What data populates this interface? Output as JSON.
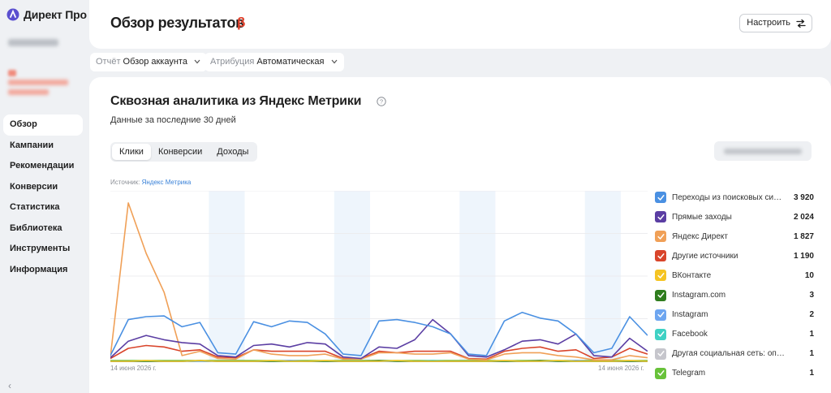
{
  "app": {
    "name": "Директ Про"
  },
  "sidebar": {
    "nav": [
      {
        "label": "Обзор",
        "active": true
      },
      {
        "label": "Кампании",
        "active": false
      },
      {
        "label": "Рекомендации",
        "active": false
      },
      {
        "label": "Конверсии",
        "active": false
      },
      {
        "label": "Статистика",
        "active": false
      },
      {
        "label": "Библиотека",
        "active": false
      },
      {
        "label": "Инструменты",
        "active": false
      },
      {
        "label": "Информация",
        "active": false
      }
    ],
    "collapse_icon": "chevron-left-icon"
  },
  "header": {
    "title": "Обзор результатов",
    "beta": "β",
    "setup_button": "Настроить"
  },
  "filters": {
    "report": {
      "label": "Отчёт",
      "value": "Обзор аккаунта"
    },
    "attribution": {
      "label": "Атрибуция",
      "value": "Автоматическая"
    }
  },
  "section": {
    "title": "Сквозная аналитика из Яндекс Метрики",
    "subtitle": "Данные за последние 30 дней",
    "tabs": [
      {
        "label": "Клики",
        "active": true
      },
      {
        "label": "Конверсии",
        "active": false
      },
      {
        "label": "Доходы",
        "active": false
      }
    ],
    "source_label": "Источник:",
    "source_link": "Яндекс Метрика"
  },
  "chart_data": {
    "type": "line",
    "x_start_label": "14 июня 2026 г.",
    "x_end_label": "14 июня 2026 г.",
    "ylim": [
      0,
      230
    ],
    "series": [
      {
        "name": "Переходы из поисковых сист...",
        "total": "3 920",
        "color": "#4a90e2",
        "values": [
          8,
          58,
          62,
          63,
          48,
          54,
          12,
          10,
          55,
          48,
          56,
          54,
          38,
          10,
          8,
          56,
          58,
          54,
          48,
          38,
          10,
          8,
          56,
          68,
          60,
          56,
          38,
          12,
          18,
          62,
          36
        ]
      },
      {
        "name": "Прямые заходы",
        "total": "2 024",
        "color": "#5b3ea3",
        "values": [
          5,
          28,
          36,
          30,
          26,
          24,
          8,
          6,
          22,
          24,
          20,
          26,
          24,
          6,
          4,
          20,
          18,
          30,
          58,
          38,
          8,
          6,
          16,
          28,
          30,
          24,
          38,
          8,
          6,
          32,
          14
        ]
      },
      {
        "name": "Яндекс Директ",
        "total": "1 827",
        "color": "#f0a057",
        "values": [
          6,
          220,
          150,
          96,
          8,
          14,
          4,
          3,
          16,
          10,
          8,
          8,
          10,
          3,
          3,
          12,
          12,
          10,
          10,
          12,
          3,
          2,
          10,
          12,
          12,
          8,
          6,
          2,
          2,
          8,
          5
        ]
      },
      {
        "name": "Другие источники",
        "total": "1 190",
        "color": "#d9452b",
        "values": [
          4,
          18,
          22,
          20,
          14,
          16,
          6,
          5,
          16,
          14,
          14,
          14,
          14,
          4,
          4,
          14,
          12,
          14,
          14,
          14,
          4,
          3,
          14,
          18,
          20,
          14,
          16,
          4,
          6,
          18,
          10
        ]
      },
      {
        "name": "ВКонтакте",
        "total": "10",
        "color": "#f5c423",
        "values": [
          0,
          0,
          1,
          0,
          0,
          1,
          0,
          0,
          0,
          1,
          0,
          0,
          1,
          0,
          0,
          0,
          1,
          0,
          0,
          0,
          0,
          0,
          1,
          0,
          0,
          1,
          0,
          0,
          0,
          1,
          0
        ]
      },
      {
        "name": "Instagram.com",
        "total": "3",
        "color": "#2f7d1e",
        "values": [
          0,
          0,
          0,
          0,
          0,
          1,
          0,
          0,
          0,
          0,
          0,
          0,
          0,
          0,
          0,
          1,
          0,
          0,
          0,
          0,
          0,
          0,
          0,
          0,
          1,
          0,
          0,
          0,
          0,
          0,
          0
        ]
      },
      {
        "name": "Instagram",
        "total": "2",
        "color": "#6ea6f0",
        "values": [
          0,
          0,
          0,
          0,
          0,
          0,
          0,
          0,
          0,
          0,
          1,
          0,
          0,
          0,
          0,
          0,
          0,
          0,
          0,
          0,
          0,
          0,
          0,
          0,
          0,
          0,
          1,
          0,
          0,
          0,
          0
        ]
      },
      {
        "name": "Facebook",
        "total": "1",
        "color": "#3fd1c4",
        "values": [
          0,
          0,
          0,
          0,
          0,
          0,
          0,
          0,
          0,
          0,
          0,
          0,
          0,
          0,
          0,
          0,
          0,
          0,
          1,
          0,
          0,
          0,
          0,
          0,
          0,
          0,
          0,
          0,
          0,
          0,
          0
        ]
      },
      {
        "name": "Другая социальная сеть: определ...",
        "total": "1",
        "color": "#c6c6cc",
        "values": [
          0,
          0,
          0,
          0,
          0,
          0,
          0,
          0,
          0,
          0,
          0,
          0,
          0,
          0,
          0,
          0,
          0,
          0,
          0,
          0,
          0,
          0,
          1,
          0,
          0,
          0,
          0,
          0,
          0,
          0,
          0
        ]
      },
      {
        "name": "Telegram",
        "total": "1",
        "color": "#68c23a",
        "values": [
          1,
          1,
          1,
          1,
          1,
          1,
          1,
          1,
          1,
          1,
          1,
          1,
          1,
          1,
          1,
          1,
          1,
          1,
          1,
          1,
          1,
          1,
          1,
          1,
          1,
          1,
          1,
          1,
          1,
          1,
          1
        ]
      }
    ],
    "weekend_bands": [
      [
        6,
        7
      ],
      [
        13,
        14
      ],
      [
        20,
        21
      ],
      [
        27,
        28
      ]
    ],
    "grid": true
  },
  "icons": {
    "logo": "direct-logo-icon",
    "setup": "settings-sliders-icon",
    "help": "help-circle-icon",
    "dropdown": "chevron-down-icon",
    "check": "check-icon"
  }
}
